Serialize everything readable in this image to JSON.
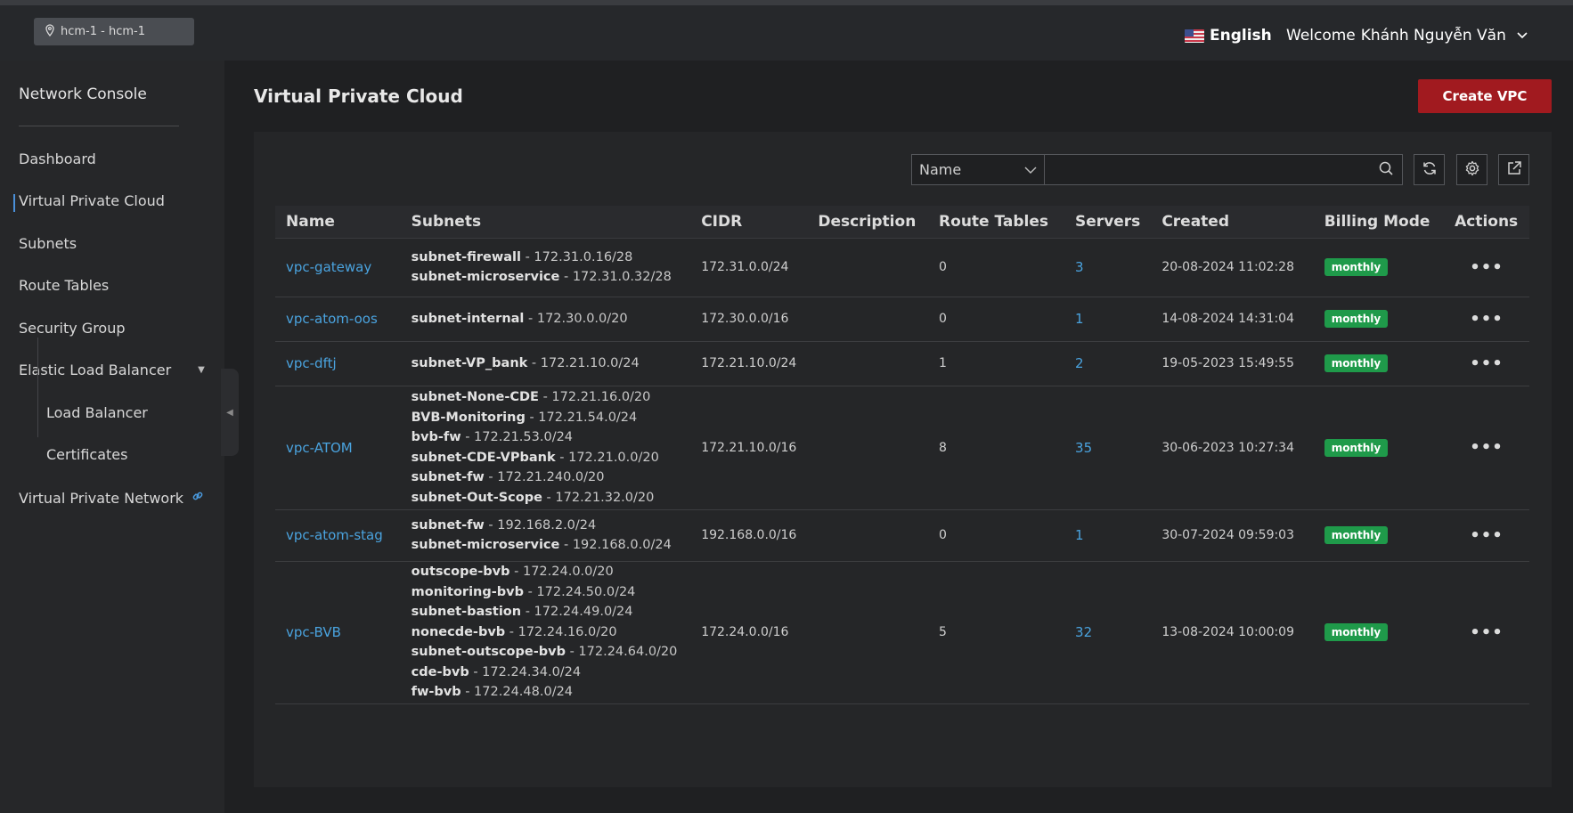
{
  "header": {
    "region": "hcm-1 - hcm-1",
    "language": "English",
    "welcome_label": "Welcome",
    "user_name": "Khánh Nguyễn Văn"
  },
  "sidebar": {
    "title": "Network Console",
    "items": [
      {
        "label": "Dashboard"
      },
      {
        "label": "Virtual Private Cloud"
      },
      {
        "label": "Subnets"
      },
      {
        "label": "Route Tables"
      },
      {
        "label": "Security Group"
      },
      {
        "label": "Elastic Load Balancer"
      },
      {
        "label": "Load Balancer"
      },
      {
        "label": "Certificates"
      },
      {
        "label": "Virtual Private Network"
      }
    ]
  },
  "main": {
    "title": "Virtual Private Cloud",
    "create_button": "Create VPC",
    "filter": {
      "field": "Name",
      "placeholder": ""
    },
    "columns": [
      "Name",
      "Subnets",
      "CIDR",
      "Description",
      "Route Tables",
      "Servers",
      "Created",
      "Billing Mode",
      "Actions"
    ],
    "rows": [
      {
        "name": "vpc-gateway",
        "subnets": [
          {
            "name": "subnet-firewall",
            "cidr": " - 172.31.0.16/28"
          },
          {
            "name": "subnet-microservice",
            "cidr": " - 172.31.0.32/28"
          }
        ],
        "cidr": "172.31.0.0/24",
        "description": "",
        "route_tables": "0",
        "servers": "3",
        "created": "20-08-2024 11:02:28",
        "billing": "monthly"
      },
      {
        "name": "vpc-atom-oos",
        "subnets": [
          {
            "name": "subnet-internal",
            "cidr": " - 172.30.0.0/20"
          }
        ],
        "cidr": "172.30.0.0/16",
        "description": "",
        "route_tables": "0",
        "servers": "1",
        "created": "14-08-2024 14:31:04",
        "billing": "monthly"
      },
      {
        "name": "vpc-dftj",
        "subnets": [
          {
            "name": "subnet-VP_bank",
            "cidr": " - 172.21.10.0/24"
          }
        ],
        "cidr": "172.21.10.0/24",
        "description": "",
        "route_tables": "1",
        "servers": "2",
        "created": "19-05-2023 15:49:55",
        "billing": "monthly"
      },
      {
        "name": "vpc-ATOM",
        "subnets": [
          {
            "name": "subnet-None-CDE",
            "cidr": " - 172.21.16.0/20"
          },
          {
            "name": "BVB-Monitoring",
            "cidr": " - 172.21.54.0/24"
          },
          {
            "name": "bvb-fw",
            "cidr": " - 172.21.53.0/24"
          },
          {
            "name": "subnet-CDE-VPbank",
            "cidr": " - 172.21.0.0/20"
          },
          {
            "name": "subnet-fw",
            "cidr": " - 172.21.240.0/20"
          },
          {
            "name": "subnet-Out-Scope",
            "cidr": " - 172.21.32.0/20"
          }
        ],
        "cidr": "172.21.10.0/16",
        "description": "",
        "route_tables": "8",
        "servers": "35",
        "created": "30-06-2023 10:27:34",
        "billing": "monthly"
      },
      {
        "name": "vpc-atom-stag",
        "subnets": [
          {
            "name": "subnet-fw",
            "cidr": " - 192.168.2.0/24"
          },
          {
            "name": "subnet-microservice",
            "cidr": " - 192.168.0.0/24"
          }
        ],
        "cidr": "192.168.0.0/16",
        "description": "",
        "route_tables": "0",
        "servers": "1",
        "created": "30-07-2024 09:59:03",
        "billing": "monthly"
      },
      {
        "name": "vpc-BVB",
        "subnets": [
          {
            "name": "outscope-bvb",
            "cidr": " - 172.24.0.0/20"
          },
          {
            "name": "monitoring-bvb",
            "cidr": " - 172.24.50.0/24"
          },
          {
            "name": "subnet-bastion",
            "cidr": " - 172.24.49.0/24"
          },
          {
            "name": "nonecde-bvb",
            "cidr": " - 172.24.16.0/20"
          },
          {
            "name": "subnet-outscope-bvb",
            "cidr": " - 172.24.64.0/20"
          },
          {
            "name": "cde-bvb",
            "cidr": " - 172.24.34.0/24"
          },
          {
            "name": "fw-bvb",
            "cidr": " - 172.24.48.0/24"
          }
        ],
        "cidr": "172.24.0.0/16",
        "description": "",
        "route_tables": "5",
        "servers": "32",
        "created": "13-08-2024 10:00:09",
        "billing": "monthly"
      }
    ]
  },
  "colors": {
    "accent_link": "#4aa3df",
    "create_button": "#a11a1f",
    "badge_green": "#1f9a4a"
  },
  "icons": {
    "region": "location-pin-icon",
    "language": "us-flag-icon",
    "user_menu": "chevron-down-icon",
    "search": "search-icon",
    "refresh": "refresh-icon",
    "settings": "gear-icon",
    "export": "external-link-icon",
    "actions": "more-horizontal-icon"
  }
}
